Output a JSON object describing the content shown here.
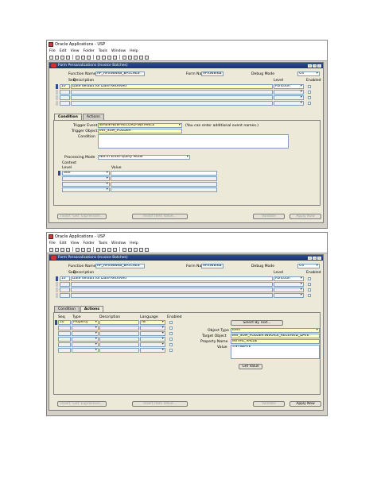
{
  "screens": [
    {
      "window_title": "Oracle Applications - USP",
      "menu": [
        "File",
        "Edit",
        "View",
        "Folder",
        "Tools",
        "Window",
        "Help"
      ],
      "form_title": "Form Personalizations (Invoice Batches)",
      "header": {
        "function_name_label": "Function Name",
        "function_name_value": "AP_APXINWKB_BATCHES",
        "form_name_label": "Form Name",
        "form_name_value": "APXINWKB",
        "debug_mode_label": "Debug Mode",
        "debug_mode_value": "Off"
      },
      "rules": {
        "seq_label": "Seq",
        "description_label": "Description",
        "level_label": "Level",
        "enabled_label": "Enabled",
        "row1_seq": "10",
        "row1_description": "Date default for Date Received",
        "row1_level": "Function"
      },
      "tabs": [
        "Condition",
        "Actions"
      ],
      "active_tab": "Condition",
      "condition": {
        "trigger_event_label": "Trigger Event",
        "trigger_event_value": "WHEN-NEW-RECORD-INSTANCE",
        "trigger_event_hint": "(You can enter additional event names.)",
        "trigger_object_label": "Trigger Object",
        "trigger_object_value": "INV_SUM_FOLDER",
        "condition_label": "Condition",
        "processing_mode_label": "Processing Mode",
        "processing_mode_value": "Not in Enter-Query Mode",
        "context_label": "Context",
        "level_col": "Level",
        "value_col": "Value",
        "context_row1_level": "Site"
      },
      "buttons": {
        "insert_get": "Insert 'Get' Expression...",
        "insert_item": "Insert Item Value...",
        "validate": "Validate",
        "apply_now": "Apply Now"
      }
    },
    {
      "window_title": "Oracle Applications - USP",
      "menu": [
        "File",
        "Edit",
        "View",
        "Folder",
        "Tools",
        "Window",
        "Help"
      ],
      "form_title": "Form Personalizations (Invoice Batches)",
      "header": {
        "function_name_label": "Function Name",
        "function_name_value": "AP_APXINWKB_BATCHES",
        "form_name_label": "Form Name",
        "form_name_value": "APXINWKB",
        "debug_mode_label": "Debug Mode",
        "debug_mode_value": "Off"
      },
      "rules": {
        "seq_label": "Seq",
        "description_label": "Description",
        "level_label": "Level",
        "enabled_label": "Enabled",
        "row1_seq": "10",
        "row1_description": "Date default for Date Received",
        "row1_level": "Function"
      },
      "tabs": [
        "Condition",
        "Actions"
      ],
      "active_tab": "Actions",
      "actions": {
        "seq_col": "Seq",
        "type_col": "Type",
        "description_col": "Description",
        "language_col": "Language",
        "enabled_col": "Enabled",
        "row1_seq": "10",
        "row1_type": "Property",
        "row1_language": "All",
        "select_by_text": "Select By Text...",
        "object_type_label": "Object Type",
        "object_type_value": "Item",
        "target_object_label": "Target Object",
        "target_object_value": "INV_SUM_FOLDER.INVOICE_RECEIVED_DATE",
        "property_name_label": "Property Name",
        "property_name_value": "INITIAL_VALUE",
        "value_label": "Value",
        "value_value": "=SYSDATE",
        "get_value": "Get Value"
      },
      "buttons": {
        "insert_get": "Insert 'Get' Expression...",
        "insert_item": "Insert Item Value...",
        "validate": "Validate",
        "apply_now": "Apply Now"
      }
    }
  ]
}
